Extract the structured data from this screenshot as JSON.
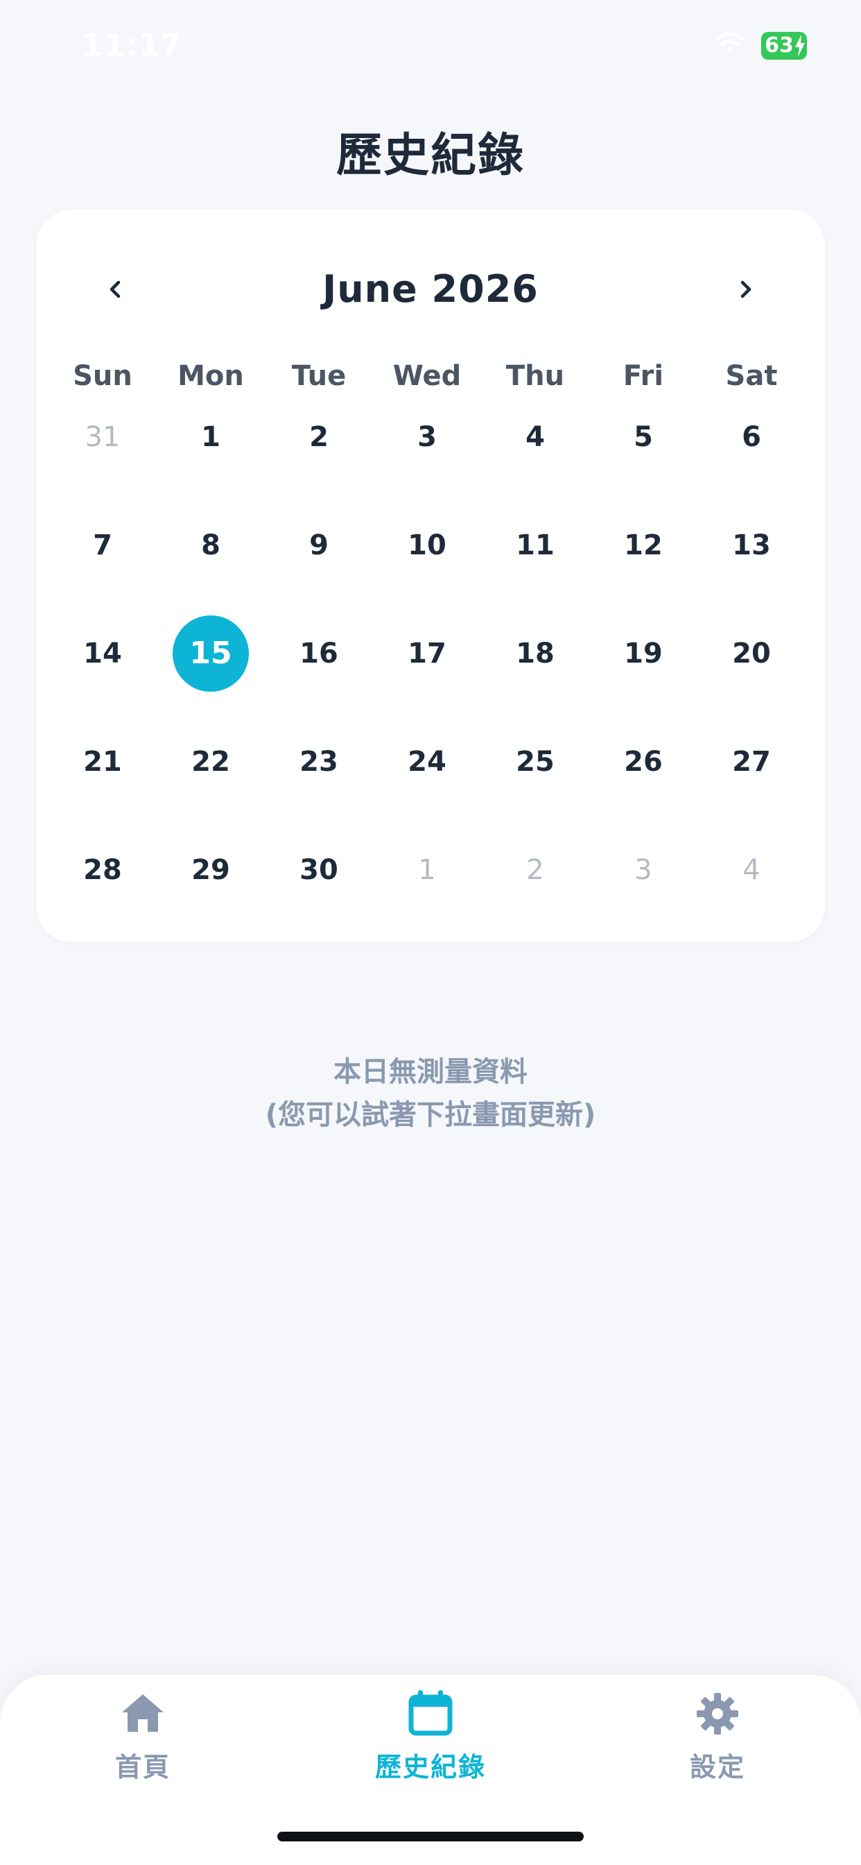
{
  "status_bar": {
    "time": "11:17",
    "battery": "63"
  },
  "title": "歷史紀錄",
  "calendar": {
    "month_label": "June 2026",
    "prev_icon": "chevron-left-icon",
    "next_icon": "chevron-right-icon",
    "weekdays": [
      "Sun",
      "Mon",
      "Tue",
      "Wed",
      "Thu",
      "Fri",
      "Sat"
    ],
    "days": [
      {
        "label": "31",
        "muted": true
      },
      {
        "label": "1"
      },
      {
        "label": "2"
      },
      {
        "label": "3"
      },
      {
        "label": "4"
      },
      {
        "label": "5"
      },
      {
        "label": "6"
      },
      {
        "label": "7"
      },
      {
        "label": "8"
      },
      {
        "label": "9"
      },
      {
        "label": "10"
      },
      {
        "label": "11"
      },
      {
        "label": "12"
      },
      {
        "label": "13"
      },
      {
        "label": "14"
      },
      {
        "label": "15",
        "selected": true
      },
      {
        "label": "16"
      },
      {
        "label": "17"
      },
      {
        "label": "18"
      },
      {
        "label": "19"
      },
      {
        "label": "20"
      },
      {
        "label": "21"
      },
      {
        "label": "22"
      },
      {
        "label": "23"
      },
      {
        "label": "24"
      },
      {
        "label": "25"
      },
      {
        "label": "26"
      },
      {
        "label": "27"
      },
      {
        "label": "28"
      },
      {
        "label": "29"
      },
      {
        "label": "30"
      },
      {
        "label": "1",
        "muted": true
      },
      {
        "label": "2",
        "muted": true
      },
      {
        "label": "3",
        "muted": true
      },
      {
        "label": "4",
        "muted": true
      }
    ],
    "accent_color": "#0EB4D6"
  },
  "empty_state": {
    "line1": "本日無測量資料",
    "line2": "(您可以試著下拉畫面更新)"
  },
  "tab_bar": {
    "tabs": [
      {
        "label": "首頁",
        "icon": "home-icon",
        "active": false
      },
      {
        "label": "歷史紀錄",
        "icon": "calendar-icon",
        "active": true
      },
      {
        "label": "設定",
        "icon": "gear-icon",
        "active": false
      }
    ],
    "active_color": "#0EB4D6",
    "inactive_color": "#8A99B0"
  }
}
